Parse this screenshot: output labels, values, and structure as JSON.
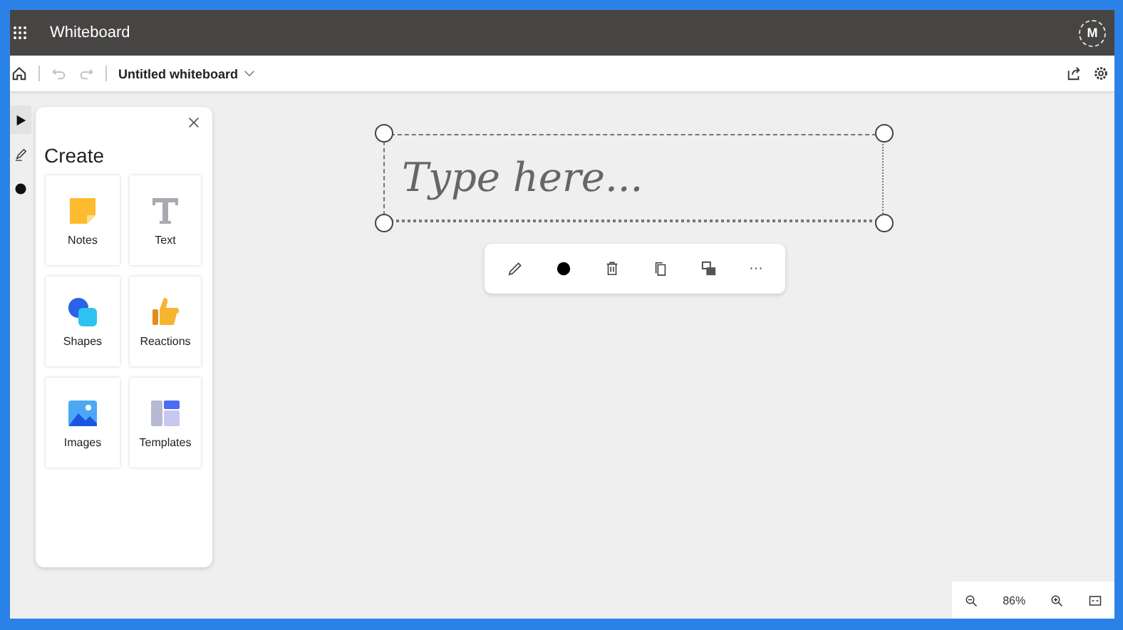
{
  "title_bar": {
    "title": "Whiteboard",
    "avatar": "M"
  },
  "toolbar": {
    "document_title": "Untitled whiteboard"
  },
  "tool_rail": [
    {
      "kind": "select",
      "selected": true
    },
    {
      "kind": "pen",
      "selected": false
    },
    {
      "kind": "color",
      "selected": false
    }
  ],
  "create_panel": {
    "heading": "Create",
    "items": [
      {
        "label": "Notes",
        "kind": "notes"
      },
      {
        "label": "Text",
        "kind": "text"
      },
      {
        "label": "Shapes",
        "kind": "shapes"
      },
      {
        "label": "Reactions",
        "kind": "reactions"
      },
      {
        "label": "Images",
        "kind": "images"
      },
      {
        "label": "Templates",
        "kind": "templates"
      }
    ]
  },
  "text_box": {
    "placeholder": "Type here..."
  },
  "context_toolbar": [
    {
      "kind": "pen"
    },
    {
      "kind": "color"
    },
    {
      "kind": "delete"
    },
    {
      "kind": "copy"
    },
    {
      "kind": "format"
    },
    {
      "kind": "more",
      "label": "···"
    }
  ],
  "zoom_bar": {
    "level": "86%"
  }
}
